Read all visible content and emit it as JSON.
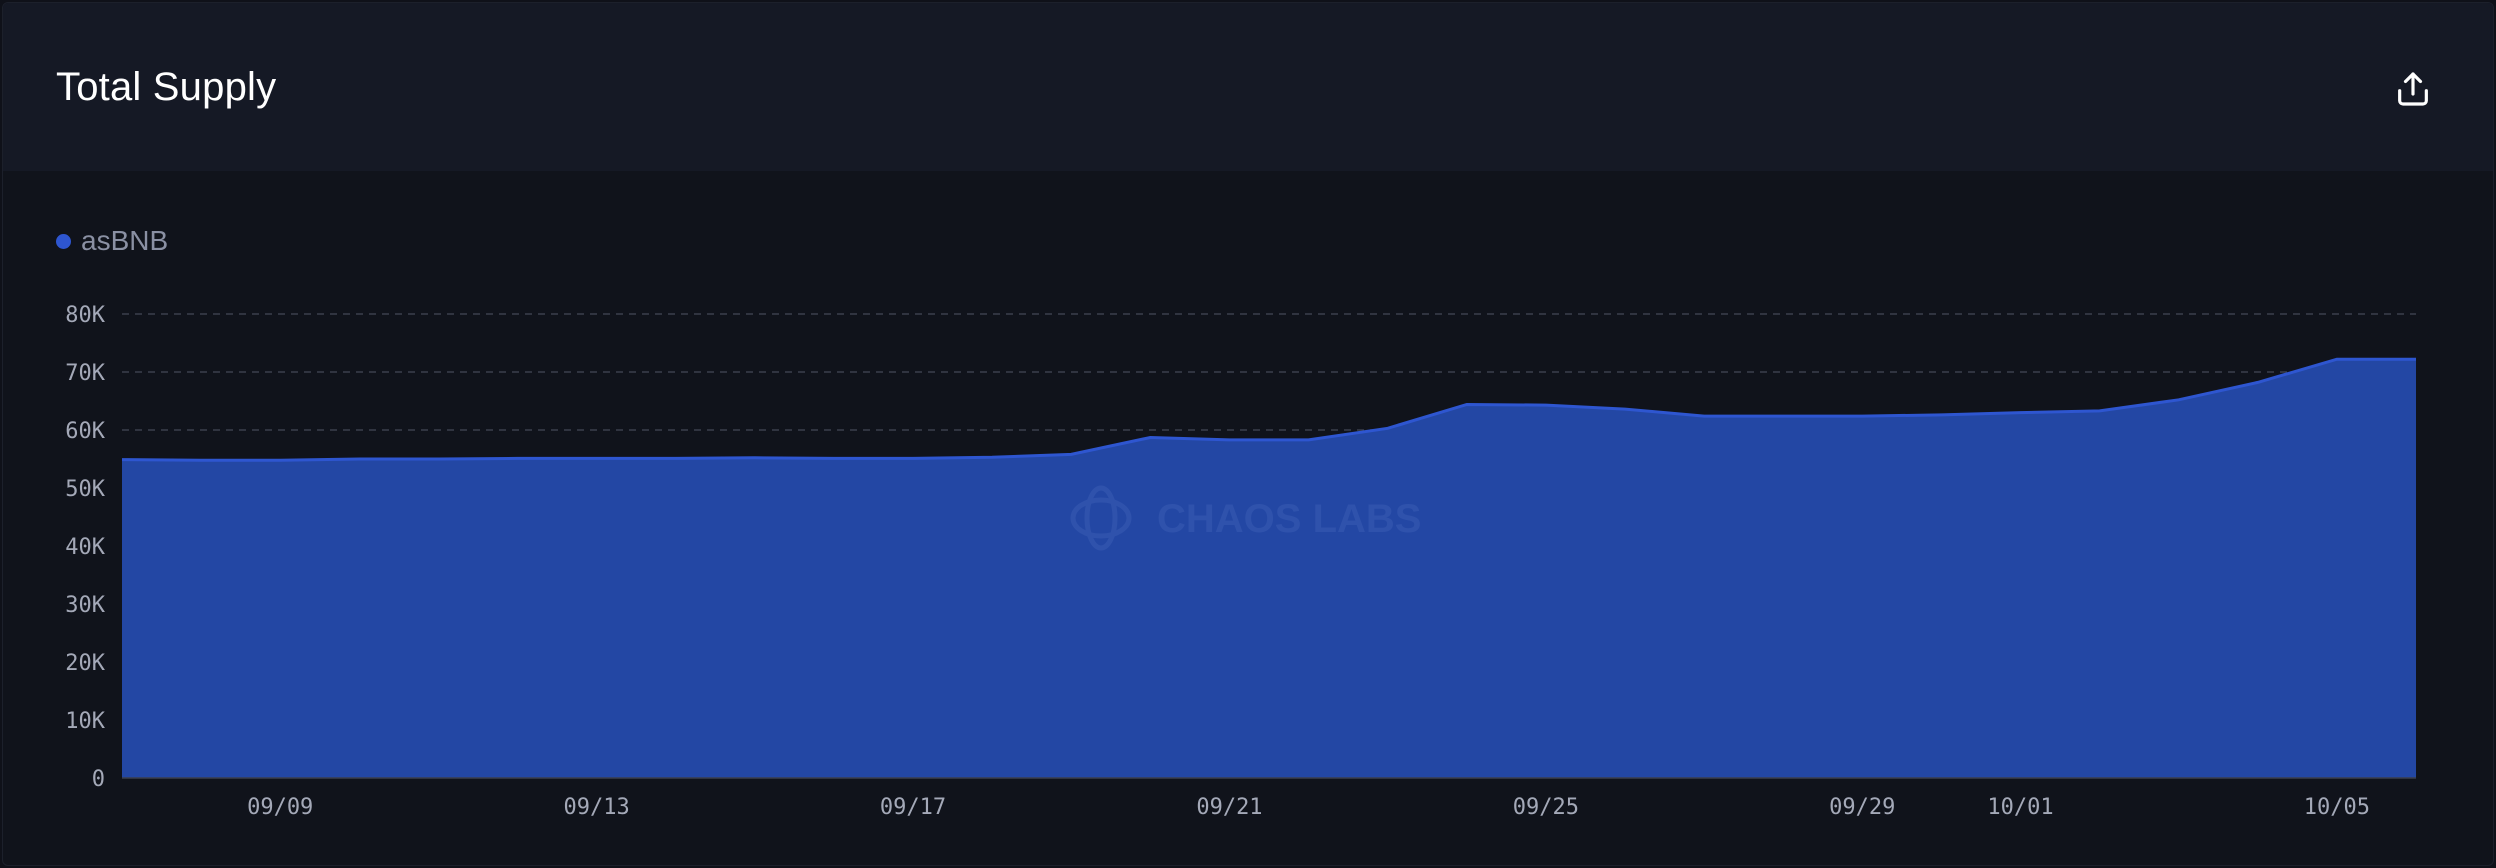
{
  "header": {
    "title": "Total Supply",
    "export_icon": "upload-icon"
  },
  "legend": {
    "label": "asBNB",
    "color": "#2e56d0"
  },
  "watermark": {
    "text": "CHAOS LABS",
    "icon": "chaos-labs-logo-icon"
  },
  "colors": {
    "area_fill": "#2347a4",
    "line": "#2e56d0",
    "grid": "#3a3f4d"
  },
  "chart_data": {
    "type": "area",
    "ylim": [
      0,
      80000
    ],
    "y_ticks": [
      {
        "value": 0,
        "label": "0"
      },
      {
        "value": 10000,
        "label": "10K"
      },
      {
        "value": 20000,
        "label": "20K"
      },
      {
        "value": 30000,
        "label": "30K"
      },
      {
        "value": 40000,
        "label": "40K"
      },
      {
        "value": 50000,
        "label": "50K"
      },
      {
        "value": 60000,
        "label": "60K"
      },
      {
        "value": 70000,
        "label": "70K"
      },
      {
        "value": 80000,
        "label": "80K"
      }
    ],
    "x": [
      "09/07",
      "09/08",
      "09/09",
      "09/10",
      "09/11",
      "09/12",
      "09/13",
      "09/14",
      "09/15",
      "09/16",
      "09/17",
      "09/18",
      "09/19",
      "09/20",
      "09/21",
      "09/22",
      "09/23",
      "09/24",
      "09/25",
      "09/26",
      "09/27",
      "09/28",
      "09/29",
      "09/30",
      "10/01",
      "10/02",
      "10/03",
      "10/04",
      "10/05",
      "10/06"
    ],
    "x_ticks": [
      "09/09",
      "09/13",
      "09/17",
      "09/21",
      "09/25",
      "09/29",
      "10/01",
      "10/05"
    ],
    "series": [
      {
        "name": "asBNB",
        "values": [
          54900,
          54800,
          54800,
          55000,
          55000,
          55100,
          55100,
          55100,
          55200,
          55100,
          55100,
          55300,
          55800,
          58700,
          58300,
          58300,
          60300,
          64400,
          64300,
          63600,
          62400,
          62400,
          62400,
          62600,
          63000,
          63300,
          65200,
          68200,
          72200,
          72200
        ]
      }
    ]
  }
}
